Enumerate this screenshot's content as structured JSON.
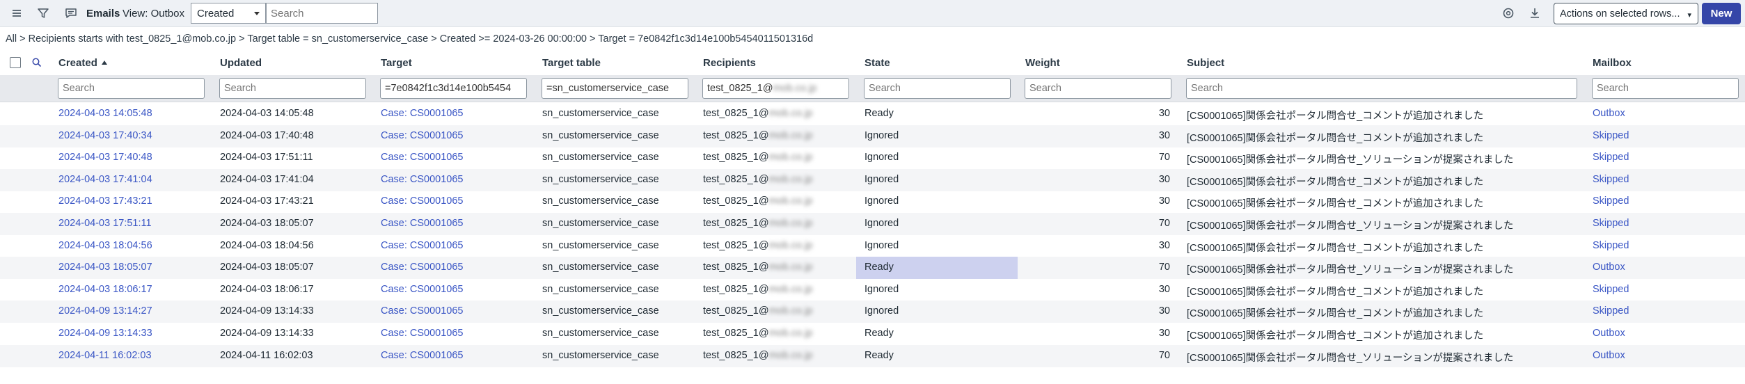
{
  "toolbar": {
    "title": "Emails",
    "view": "View: Outbox",
    "select_value": "Created",
    "search_placeholder": "Search",
    "actions_label": "Actions on selected rows...",
    "new_label": "New",
    "icons": [
      "hamburger-icon",
      "filter-icon",
      "chat-icon",
      "settings-icon",
      "download-icon"
    ]
  },
  "breadcrumb": "All > Recipients starts with test_0825_1@mob.co.jp > Target table = sn_customerservice_case > Created >= 2024-03-26 00:00:00 > Target = 7e0842f1c3d14e100b5454011501316d",
  "columns": [
    "Created",
    "Updated",
    "Target",
    "Target table",
    "Recipients",
    "State",
    "Weight",
    "Subject",
    "Mailbox"
  ],
  "filters": {
    "placeholder": "Search",
    "target": "=7e0842f1c3d14e100b5454",
    "target_table": "=sn_customerservice_case",
    "recipients": "test_0825_1@",
    "recipients_blur": "mob.co.jp"
  },
  "rows": [
    {
      "created": "2024-04-03 14:05:48",
      "updated": "2024-04-03 14:05:48",
      "target": "Case: CS0001065",
      "table": "sn_customerservice_case",
      "recip": "test_0825_1@",
      "recip_blur": "mob.co.jp",
      "state": "Ready",
      "weight": "30",
      "subject": "[CS0001065]関係会社ポータル問合せ_コメントが追加されました",
      "mailbox": "Outbox"
    },
    {
      "created": "2024-04-03 17:40:34",
      "updated": "2024-04-03 17:40:48",
      "target": "Case: CS0001065",
      "table": "sn_customerservice_case",
      "recip": "test_0825_1@",
      "recip_blur": "mob.co.jp",
      "state": "Ignored",
      "weight": "30",
      "subject": "[CS0001065]関係会社ポータル問合せ_コメントが追加されました",
      "mailbox": "Skipped"
    },
    {
      "created": "2024-04-03 17:40:48",
      "updated": "2024-04-03 17:51:11",
      "target": "Case: CS0001065",
      "table": "sn_customerservice_case",
      "recip": "test_0825_1@",
      "recip_blur": "mob.co.jp",
      "state": "Ignored",
      "weight": "70",
      "subject": "[CS0001065]関係会社ポータル問合せ_ソリューションが提案されました",
      "mailbox": "Skipped"
    },
    {
      "created": "2024-04-03 17:41:04",
      "updated": "2024-04-03 17:41:04",
      "target": "Case: CS0001065",
      "table": "sn_customerservice_case",
      "recip": "test_0825_1@",
      "recip_blur": "mob.co.jp",
      "state": "Ignored",
      "weight": "30",
      "subject": "[CS0001065]関係会社ポータル問合せ_コメントが追加されました",
      "mailbox": "Skipped"
    },
    {
      "created": "2024-04-03 17:43:21",
      "updated": "2024-04-03 17:43:21",
      "target": "Case: CS0001065",
      "table": "sn_customerservice_case",
      "recip": "test_0825_1@",
      "recip_blur": "mob.co.jp",
      "state": "Ignored",
      "weight": "30",
      "subject": "[CS0001065]関係会社ポータル問合せ_コメントが追加されました",
      "mailbox": "Skipped"
    },
    {
      "created": "2024-04-03 17:51:11",
      "updated": "2024-04-03 18:05:07",
      "target": "Case: CS0001065",
      "table": "sn_customerservice_case",
      "recip": "test_0825_1@",
      "recip_blur": "mob.co.jp",
      "state": "Ignored",
      "weight": "70",
      "subject": "[CS0001065]関係会社ポータル問合せ_ソリューションが提案されました",
      "mailbox": "Skipped"
    },
    {
      "created": "2024-04-03 18:04:56",
      "updated": "2024-04-03 18:04:56",
      "target": "Case: CS0001065",
      "table": "sn_customerservice_case",
      "recip": "test_0825_1@",
      "recip_blur": "mob.co.jp",
      "state": "Ignored",
      "weight": "30",
      "subject": "[CS0001065]関係会社ポータル問合せ_コメントが追加されました",
      "mailbox": "Skipped"
    },
    {
      "created": "2024-04-03 18:05:07",
      "updated": "2024-04-03 18:05:07",
      "target": "Case: CS0001065",
      "table": "sn_customerservice_case",
      "recip": "test_0825_1@",
      "recip_blur": "mob.co.jp",
      "state": "Ready",
      "weight": "70",
      "subject": "[CS0001065]関係会社ポータル問合せ_ソリューションが提案されました",
      "mailbox": "Outbox",
      "highlight": true
    },
    {
      "created": "2024-04-03 18:06:17",
      "updated": "2024-04-03 18:06:17",
      "target": "Case: CS0001065",
      "table": "sn_customerservice_case",
      "recip": "test_0825_1@",
      "recip_blur": "mob.co.jp",
      "state": "Ignored",
      "weight": "30",
      "subject": "[CS0001065]関係会社ポータル問合せ_コメントが追加されました",
      "mailbox": "Skipped"
    },
    {
      "created": "2024-04-09 13:14:27",
      "updated": "2024-04-09 13:14:33",
      "target": "Case: CS0001065",
      "table": "sn_customerservice_case",
      "recip": "test_0825_1@",
      "recip_blur": "mob.co.jp",
      "state": "Ignored",
      "weight": "30",
      "subject": "[CS0001065]関係会社ポータル問合せ_コメントが追加されました",
      "mailbox": "Skipped"
    },
    {
      "created": "2024-04-09 13:14:33",
      "updated": "2024-04-09 13:14:33",
      "target": "Case: CS0001065",
      "table": "sn_customerservice_case",
      "recip": "test_0825_1@",
      "recip_blur": "mob.co.jp",
      "state": "Ready",
      "weight": "30",
      "subject": "[CS0001065]関係会社ポータル問合せ_コメントが追加されました",
      "mailbox": "Outbox"
    },
    {
      "created": "2024-04-11 16:02:03",
      "updated": "2024-04-11 16:02:03",
      "target": "Case: CS0001065",
      "table": "sn_customerservice_case",
      "recip": "test_0825_1@",
      "recip_blur": "mob.co.jp",
      "state": "Ready",
      "weight": "70",
      "subject": "[CS0001065]関係会社ポータル問合せ_ソリューションが提案されました",
      "mailbox": "Outbox"
    }
  ]
}
